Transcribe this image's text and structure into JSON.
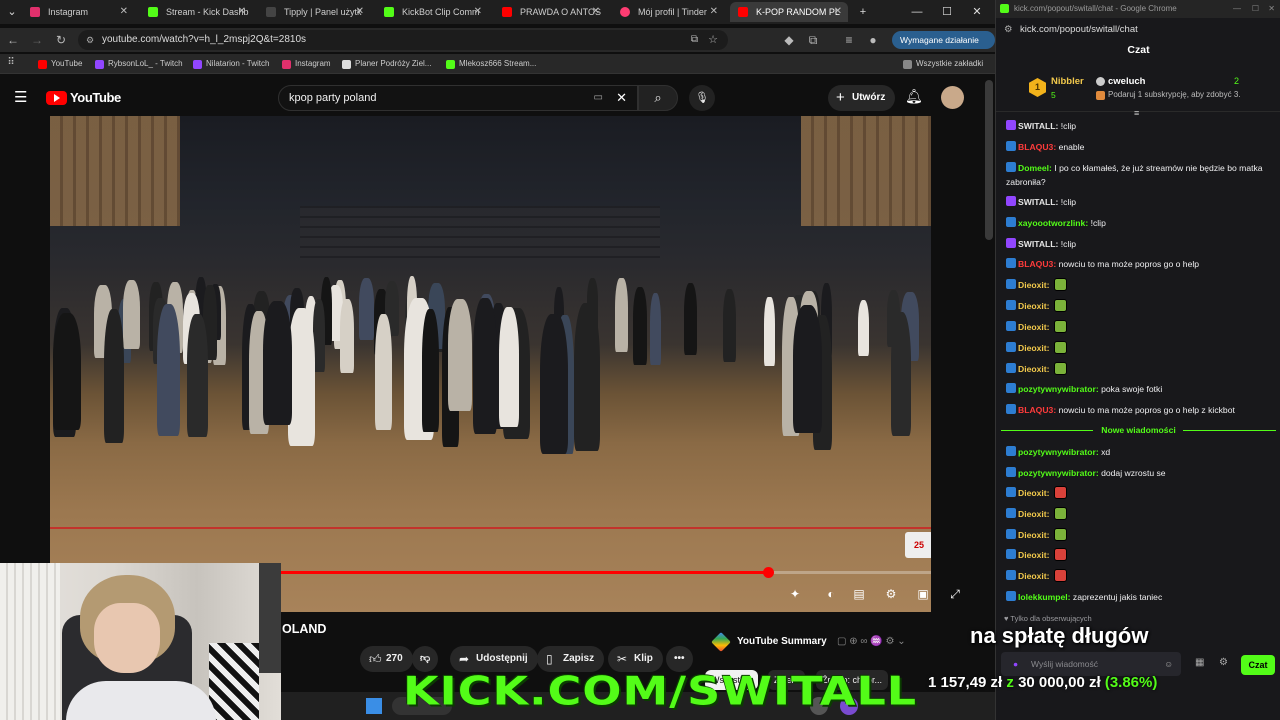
{
  "browser": {
    "tabs": [
      {
        "label": "Instagram",
        "color": "#e1306c"
      },
      {
        "label": "Stream - Kick Dashb",
        "color": "#53fc18"
      },
      {
        "label": "Tipply | Panel użytk",
        "color": "#222222"
      },
      {
        "label": "KickBot Clip Comm",
        "color": "#53fc18"
      },
      {
        "label": "PRAWDA O ANTOS",
        "color": "#ff0000"
      },
      {
        "label": "Mój profil | Tinder",
        "color": "#fe3c72"
      },
      {
        "label": "K-POP RANDOM PL",
        "color": "#ff0000"
      }
    ],
    "url": "youtube.com/watch?v=h_l_2mspj2Q&t=2810s",
    "required_action_label": "Wymagane działanie",
    "bookmarks": [
      {
        "label": "YouTube",
        "color": "#ff0000"
      },
      {
        "label": "RybsonLoL_ - Twitch",
        "color": "#9146ff"
      },
      {
        "label": "Nilatarion - Twitch",
        "color": "#9146ff"
      },
      {
        "label": "Instagram",
        "color": "#e1306c"
      },
      {
        "label": "Planer Podróży Ziel...",
        "color": "#dddddd"
      },
      {
        "label": "Mlekosz666 Stream...",
        "color": "#53fc18"
      }
    ],
    "all_bookmarks_label": "Wszystkie zakładki"
  },
  "youtube": {
    "logo_text": "YouTube",
    "search_query": "kpop party poland",
    "create_label": "Utwórz",
    "video_title_fragment": "OLAND",
    "progress_fraction": 0.75,
    "likes": "270",
    "share_label": "Udostępnij",
    "save_label": "Zapisz",
    "clip_label": "Klip",
    "summary_label": "YouTube Summary",
    "chips": [
      "Wszystkie",
      "Z serii",
      "Źródło: cheor..."
    ]
  },
  "chat_window": {
    "title": "kick.com/popout/switall/chat - Google Chrome",
    "url": "kick.com/popout/switall/chat",
    "heading": "Czat",
    "top_gifter": {
      "name": "Nibbler",
      "count": "5",
      "rank": "1"
    },
    "sub_user": "cweluch",
    "sub_count": "2",
    "sub_prompt": "Podaruj 1 subskrypcję, aby zdobyć 3.",
    "messages_before": [
      {
        "user": "SWITALL",
        "color": "#e5e5e5",
        "text": "!clip"
      },
      {
        "user": "BLAQU3",
        "color": "#ff3b3b",
        "text": "enable"
      },
      {
        "user": "Domeel",
        "color": "#53fc18",
        "text": "I po co kłamałeś, że już streamów nie będzie bo matka zabroniła?"
      },
      {
        "user": "SWITALL",
        "color": "#e5e5e5",
        "text": "!clip"
      },
      {
        "user": "xayoootworzlink",
        "color": "#53fc18",
        "text": "!clip"
      },
      {
        "user": "SWITALL",
        "color": "#e5e5e5",
        "text": "!clip"
      },
      {
        "user": "BLAQU3",
        "color": "#ff3b3b",
        "text": "nowciu to ma może popros go o help"
      },
      {
        "user": "Dieoxit",
        "color": "#f2c94c",
        "text": ""
      },
      {
        "user": "Dieoxit",
        "color": "#f2c94c",
        "text": ""
      },
      {
        "user": "Dieoxit",
        "color": "#f2c94c",
        "text": ""
      },
      {
        "user": "Dieoxit",
        "color": "#f2c94c",
        "text": ""
      },
      {
        "user": "Dieoxit",
        "color": "#f2c94c",
        "text": ""
      },
      {
        "user": "pozytywnywibrator",
        "color": "#53fc18",
        "text": "poka swoje fotki"
      },
      {
        "user": "BLAQU3",
        "color": "#ff3b3b",
        "text": "nowciu to ma może popros go o help z kickbot"
      }
    ],
    "new_messages_label": "Nowe wiadomości",
    "messages_after": [
      {
        "user": "pozytywnywibrator",
        "color": "#53fc18",
        "text": "xd"
      },
      {
        "user": "pozytywnywibrator",
        "color": "#53fc18",
        "text": "dodaj wzrostu se"
      },
      {
        "user": "Dieoxit",
        "color": "#f2c94c",
        "text": ""
      },
      {
        "user": "Dieoxit",
        "color": "#f2c94c",
        "text": ""
      },
      {
        "user": "Dieoxit",
        "color": "#f2c94c",
        "text": ""
      },
      {
        "user": "Dieoxit",
        "color": "#f2c94c",
        "text": ""
      },
      {
        "user": "Dieoxit",
        "color": "#f2c94c",
        "text": ""
      },
      {
        "user": "lolekkumpel",
        "color": "#53fc18",
        "text": "zaprezentuj jakis taniec"
      }
    ],
    "followers_only_label": "Tylko dla obserwujących",
    "input_placeholder": "Wyślij wiadomość",
    "send_label": "Czat"
  },
  "overlay": {
    "debt_text": "na spłatę długów",
    "kick_url": "KICK.COM/SWITALL",
    "raised": "1 157,49 zł",
    "sep": "z",
    "goal": "30 000,00 zł",
    "percent": "(3.86%)"
  },
  "colors": {
    "kick_green": "#53fc18",
    "yt_red": "#ff0000"
  }
}
